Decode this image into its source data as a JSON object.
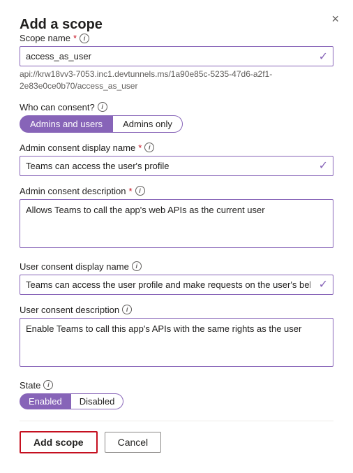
{
  "dialog": {
    "title": "Add a scope",
    "close_label": "×"
  },
  "scope_name": {
    "label": "Scope name",
    "required": true,
    "value": "access_as_user",
    "hint": "api://krw18vv3-7053.inc1.devtunnels.ms/1a90e85c-5235-47d6-a2f1-2e83e0ce0b70/access_as_user",
    "check": "✓"
  },
  "who_can_consent": {
    "label": "Who can consent?",
    "options": [
      "Admins and users",
      "Admins only"
    ],
    "active": "Admins and users"
  },
  "admin_consent_display_name": {
    "label": "Admin consent display name",
    "required": true,
    "value": "Teams can access the user's profile",
    "check": "✓"
  },
  "admin_consent_description": {
    "label": "Admin consent description",
    "required": true,
    "value": "Allows Teams to call the app's web APIs as the current user"
  },
  "user_consent_display_name": {
    "label": "User consent display name",
    "value": "Teams can access the user profile and make requests on the user's behalf",
    "check": "✓"
  },
  "user_consent_description": {
    "label": "User consent description",
    "value": "Enable Teams to call this app's APIs with the same rights as the user"
  },
  "state": {
    "label": "State",
    "options": [
      "Enabled",
      "Disabled"
    ],
    "active": "Enabled"
  },
  "actions": {
    "add_scope": "Add scope",
    "cancel": "Cancel"
  },
  "info_icon_label": "i"
}
